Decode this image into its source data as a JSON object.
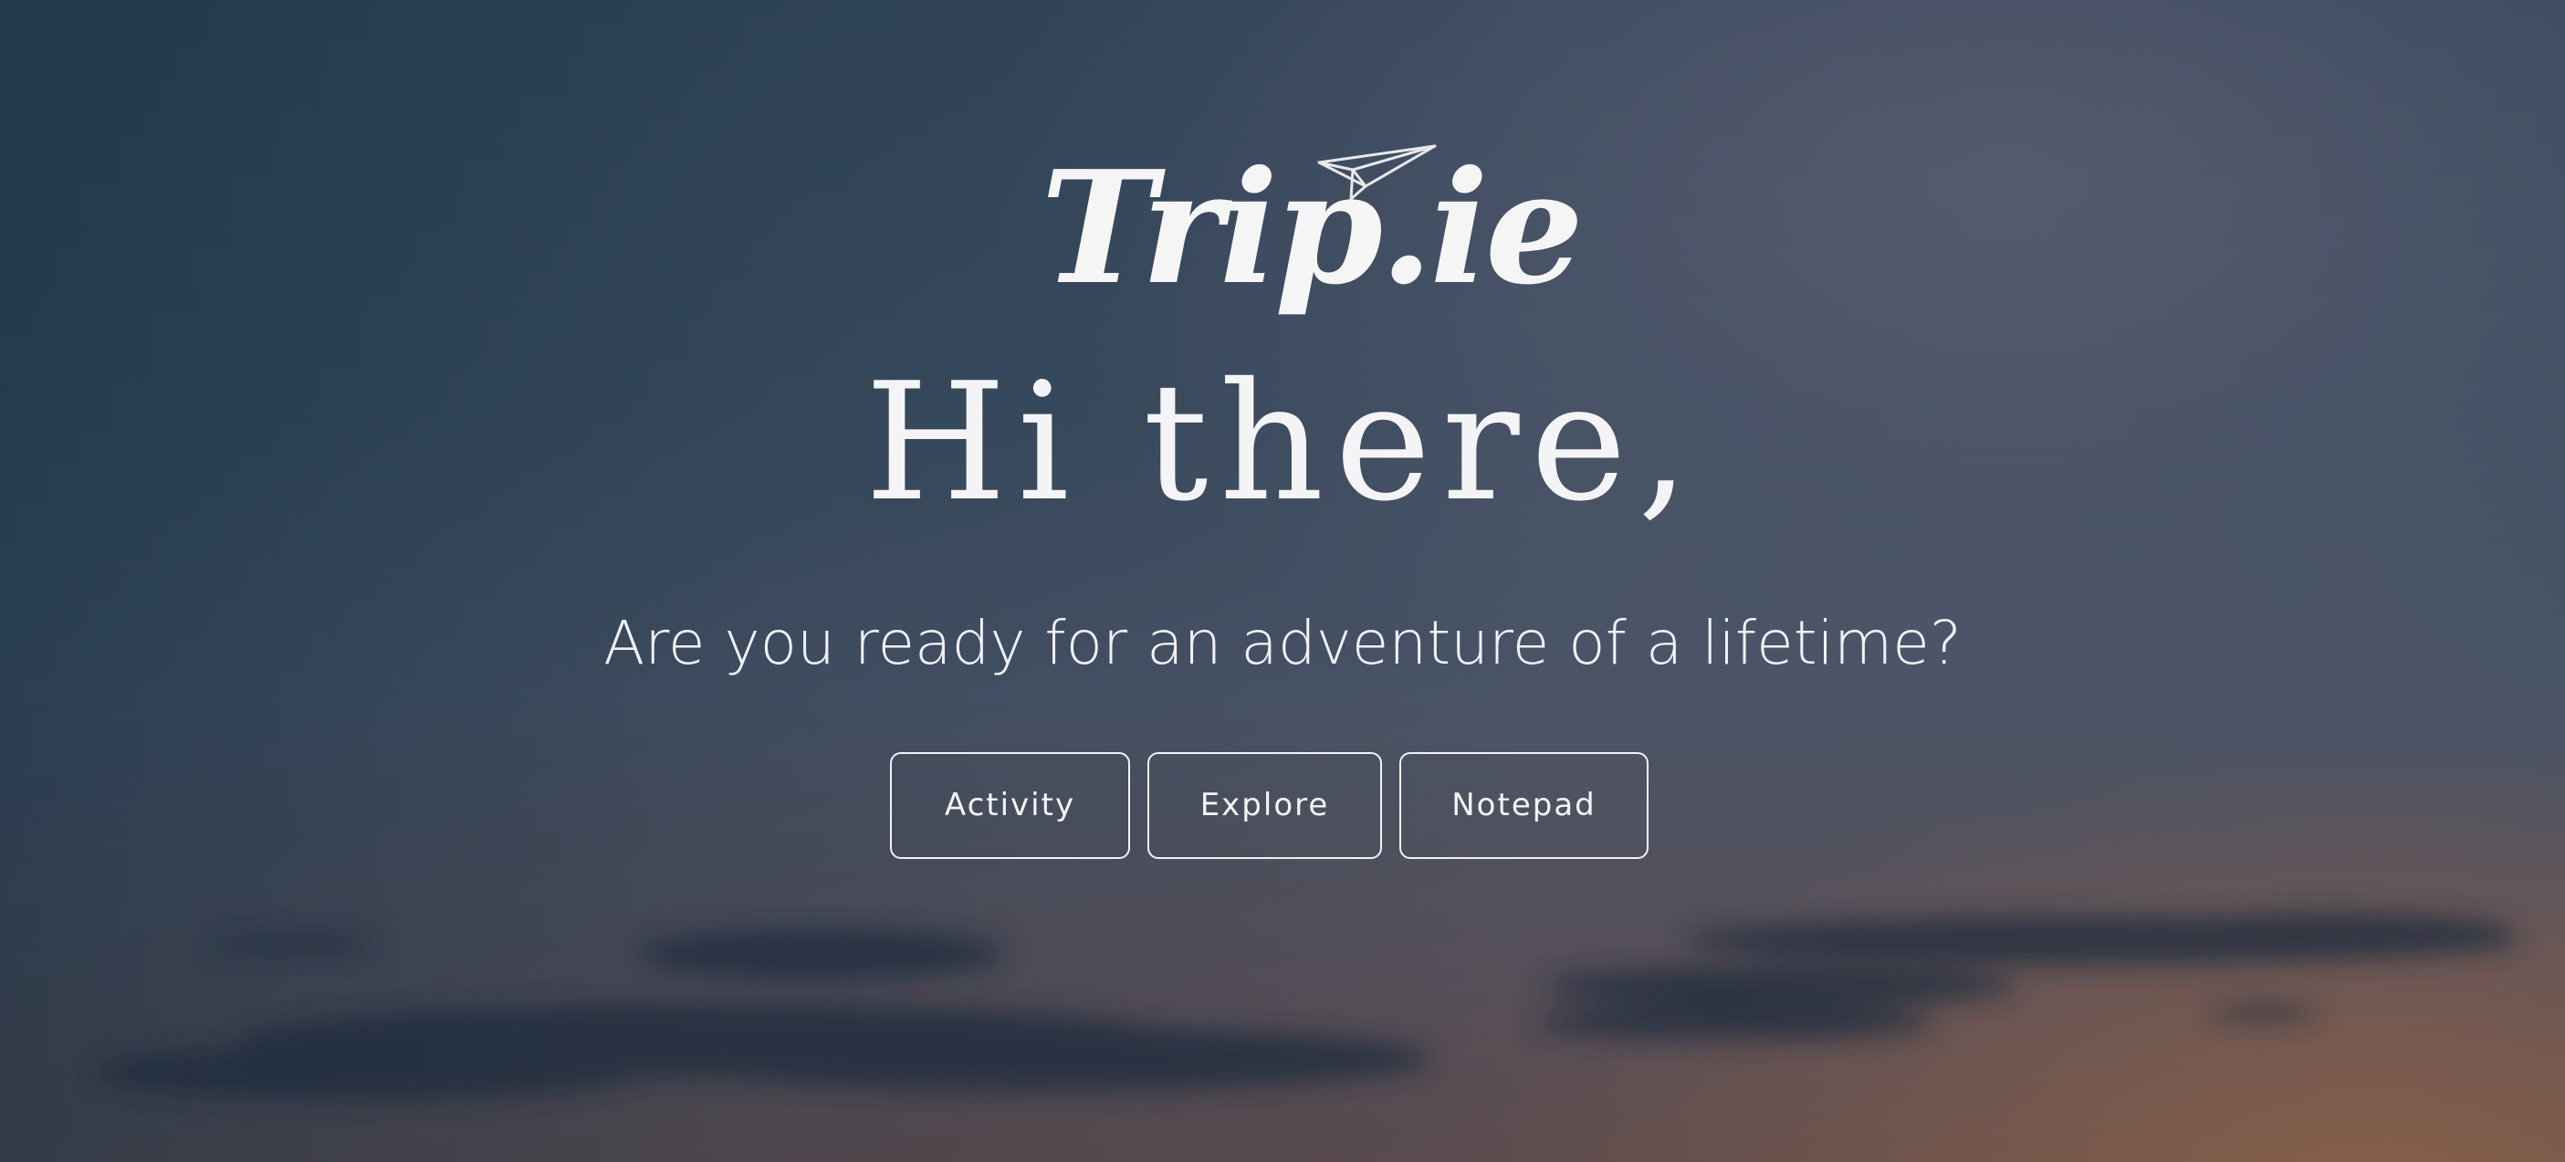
{
  "brand": {
    "logo_text": "Trip.ie",
    "logo_icon": "paper-plane-icon"
  },
  "hero": {
    "headline": "Hi there,",
    "subheadline": "Are you ready for an adventure of a lifetime?"
  },
  "actions": [
    {
      "label": "Activity"
    },
    {
      "label": "Explore"
    },
    {
      "label": "Notepad"
    }
  ],
  "colors": {
    "text": "#f4f4f6",
    "sky_top": "#34465a",
    "sky_bottom": "#5c4c4e",
    "horizon_glow": "#aa6e46"
  }
}
